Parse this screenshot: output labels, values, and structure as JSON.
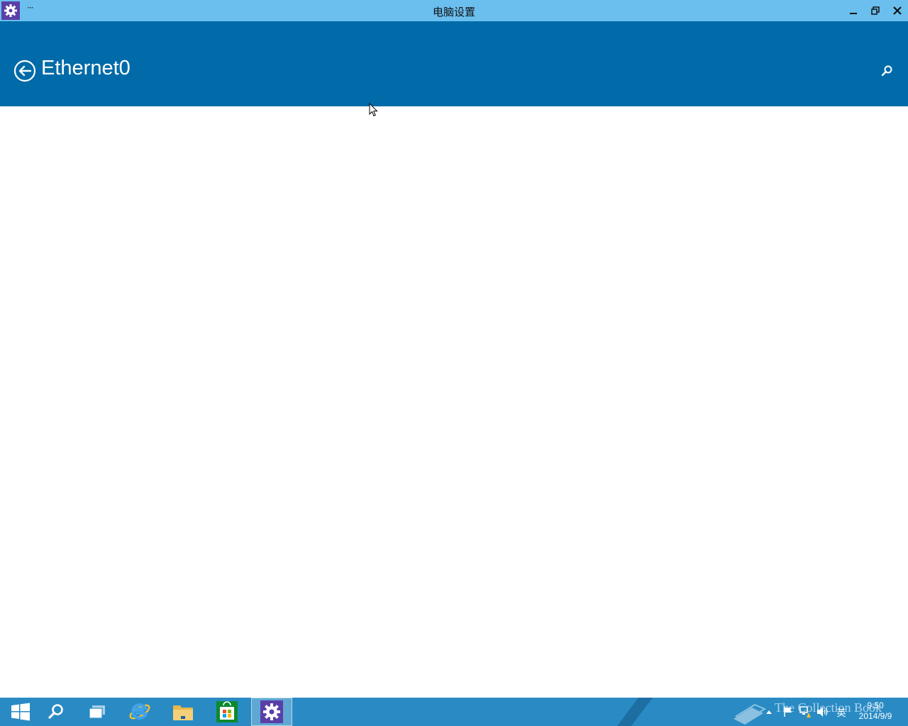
{
  "titlebar": {
    "menu_label": "···",
    "title": "电脑设置",
    "app_icon": "gear-icon"
  },
  "header": {
    "back_icon": "back-arrow-icon",
    "page_title": "Ethernet0",
    "search_icon": "search-icon"
  },
  "taskbar": {
    "items": [
      "start-icon",
      "search-icon",
      "task-view-icon",
      "internet-explorer-icon",
      "file-explorer-icon",
      "store-icon",
      "settings-icon"
    ],
    "active_item": "settings",
    "tray": {
      "ime_label": "英",
      "time": "9:50",
      "date": "2014/9/9"
    }
  },
  "watermark": {
    "text": "The Collection Book"
  },
  "colors": {
    "titlebar": "#6abfee",
    "header": "#006ba8",
    "taskbar": "#2a8bc4",
    "app_icon_bg": "#5a3fa8"
  }
}
